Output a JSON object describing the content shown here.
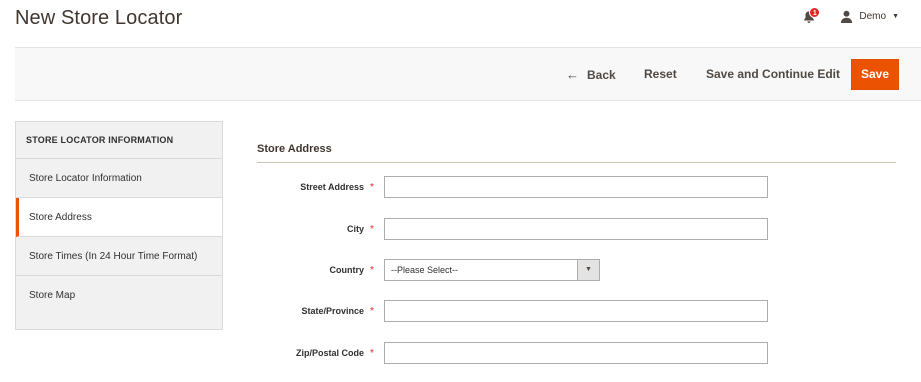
{
  "page": {
    "title": "New Store Locator"
  },
  "header": {
    "notification_count": "1",
    "user_name": "Demo"
  },
  "action_bar": {
    "back_label": "Back",
    "reset_label": "Reset",
    "save_continue_label": "Save and Continue Edit",
    "save_label": "Save",
    "save_color": "#eb5202"
  },
  "sidebar": {
    "title": "STORE LOCATOR INFORMATION",
    "items": [
      {
        "label": "Store Locator Information"
      },
      {
        "label": "Store Address"
      },
      {
        "label": "Store Times (In 24 Hour Time Format)"
      },
      {
        "label": "Store Map"
      }
    ],
    "active_index": 1
  },
  "form": {
    "section_title": "Store Address",
    "fields": {
      "street": {
        "label": "Street Address",
        "value": ""
      },
      "city": {
        "label": "City",
        "value": ""
      },
      "country": {
        "label": "Country",
        "selected": "--Please Select--"
      },
      "state": {
        "label": "State/Province",
        "value": ""
      },
      "zip": {
        "label": "Zip/Postal Code",
        "value": ""
      }
    },
    "required_mark": "*"
  }
}
